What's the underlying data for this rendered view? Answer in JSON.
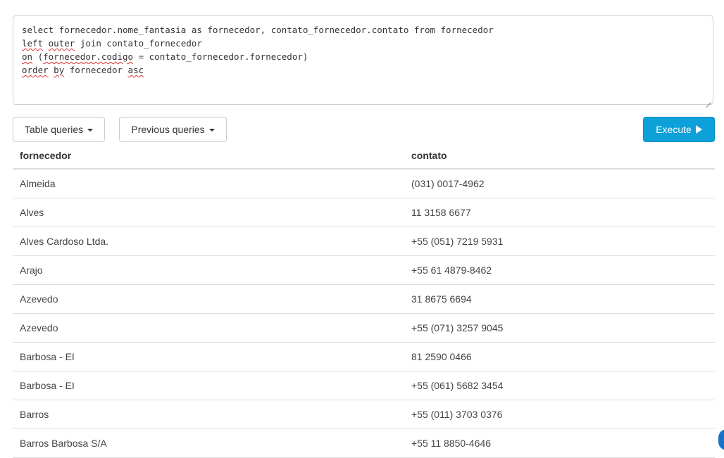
{
  "editor": {
    "lines": [
      [
        {
          "t": "select fornecedor.nome_fantasia as fornecedor, contato_fornecedor.contato from fornecedor",
          "sq": false
        }
      ],
      [
        {
          "t": "left",
          "sq": true
        },
        {
          "t": " ",
          "sq": false
        },
        {
          "t": "outer",
          "sq": true
        },
        {
          "t": " join contato_fornecedor",
          "sq": false
        }
      ],
      [
        {
          "t": "on",
          "sq": true
        },
        {
          "t": " (",
          "sq": false
        },
        {
          "t": "fornecedor.codigo",
          "sq": true
        },
        {
          "t": " = contato_fornecedor.fornecedor)",
          "sq": false
        }
      ],
      [
        {
          "t": "order",
          "sq": true
        },
        {
          "t": " ",
          "sq": false
        },
        {
          "t": "by",
          "sq": true
        },
        {
          "t": " fornecedor ",
          "sq": false
        },
        {
          "t": "asc",
          "sq": true
        }
      ]
    ]
  },
  "toolbar": {
    "table_queries_label": "Table queries",
    "previous_queries_label": "Previous queries",
    "execute_label": "Execute"
  },
  "table": {
    "headers": [
      "fornecedor",
      "contato"
    ],
    "rows": [
      [
        "Almeida",
        "(031) 0017-4962"
      ],
      [
        "Alves",
        "11 3158 6677"
      ],
      [
        "Alves Cardoso Ltda.",
        "+55 (051) 7219 5931"
      ],
      [
        "Arajo",
        "+55 61 4879-8462"
      ],
      [
        "Azevedo",
        "31 8675 6694"
      ],
      [
        "Azevedo",
        "+55 (071) 3257 9045"
      ],
      [
        "Barbosa - EI",
        "81 2590 0466"
      ],
      [
        "Barbosa - EI",
        "+55 (061) 5682 3454"
      ],
      [
        "Barros",
        "+55 (011) 3703 0376"
      ],
      [
        "Barros Barbosa S/A",
        "+55 11 8850-4646"
      ]
    ]
  },
  "colors": {
    "accent": "#0ea0d9",
    "border": "#cccccc"
  }
}
